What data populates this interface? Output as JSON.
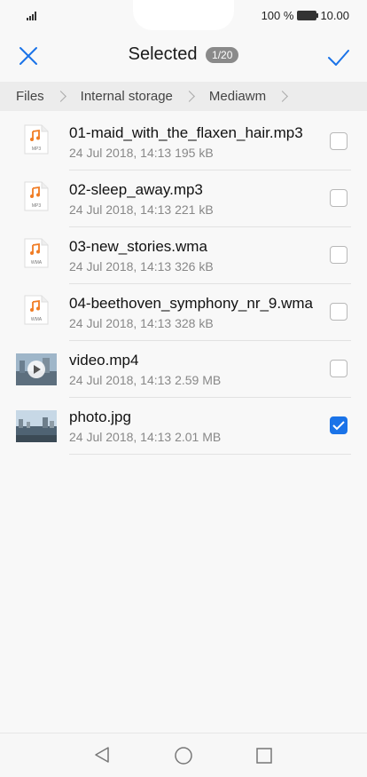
{
  "status": {
    "battery_text": "100 %",
    "time": "10.00"
  },
  "toolbar": {
    "title": "Selected",
    "count": "1/20",
    "close_icon": "close-icon",
    "confirm_icon": "checkmark-icon"
  },
  "breadcrumb": [
    "Files",
    "Internal storage",
    "Mediawm"
  ],
  "files": [
    {
      "name": "01-maid_with_the_flaxen_hair.mp3",
      "meta": "24 Jul 2018, 14:13 195 kB",
      "type": "MP3",
      "checked": false
    },
    {
      "name": "02-sleep_away.mp3",
      "meta": "24 Jul 2018, 14:13 221 kB",
      "type": "MP3",
      "checked": false
    },
    {
      "name": "03-new_stories.wma",
      "meta": "24 Jul 2018, 14:13 326 kB",
      "type": "WMA",
      "checked": false
    },
    {
      "name": "04-beethoven_symphony_nr_9.wma",
      "meta": "24 Jul 2018, 14:13 328 kB",
      "type": "WMA",
      "checked": false
    },
    {
      "name": "video.mp4",
      "meta": "24 Jul 2018, 14:13 2.59 MB",
      "type": "video",
      "checked": false
    },
    {
      "name": "photo.jpg",
      "meta": "24 Jul 2018, 14:13 2.01 MB",
      "type": "image",
      "checked": true
    }
  ],
  "colors": {
    "accent": "#1a73e8",
    "music": "#f07c24"
  }
}
